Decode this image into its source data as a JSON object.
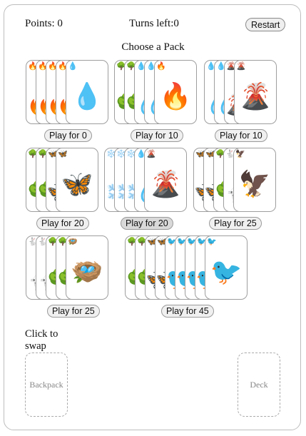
{
  "header": {
    "points_text": "Points: 0",
    "turns_text": "Turns left:0",
    "restart_label": "Restart"
  },
  "choose_label": "Choose a Pack",
  "packs": [
    {
      "name": "water",
      "emoji": "💧",
      "label": "Play for 0",
      "cards": [
        "🔥",
        "🔥",
        "🔥",
        "🔥",
        "💧"
      ]
    },
    {
      "name": "fire",
      "emoji": "🔥",
      "label": "Play for 10",
      "cards": [
        "🌳",
        "🌳",
        "💧",
        "💧",
        "🔥"
      ]
    },
    {
      "name": "volcano",
      "emoji": "🌋",
      "label": "Play for 10",
      "cards": [
        "💧",
        "💧",
        "🌋",
        "🌋"
      ]
    },
    {
      "name": "butterfly",
      "emoji": "🦋",
      "label": "Play for 20",
      "cards": [
        "🌳",
        "🌳",
        "🦋",
        "🦋"
      ]
    },
    {
      "name": "volcano",
      "emoji": "🌋",
      "label": "Play for 20",
      "cards": [
        "❄️",
        "❄️",
        "❄️",
        "💧",
        "🌋"
      ]
    },
    {
      "name": "eagle",
      "emoji": "🦅",
      "label": "Play for 25",
      "cards": [
        "🦋",
        "🦋",
        "🌳",
        "🐇",
        "🦅"
      ]
    },
    {
      "name": "nest",
      "emoji": "🪺",
      "label": "Play for 25",
      "cards": [
        "🐇",
        "🐇",
        "🌳",
        "🌳",
        "🪺"
      ]
    },
    {
      "name": "bird",
      "emoji": "🐦",
      "label": "Play for 45",
      "cards": [
        "🌳",
        "🌳",
        "🦋",
        "🦋",
        "🐦",
        "🐦",
        "🐦",
        "🐦",
        "🐦"
      ]
    }
  ],
  "swap_label": "Click to swap",
  "backpack_label": "Backpack",
  "deck_label": "Deck"
}
